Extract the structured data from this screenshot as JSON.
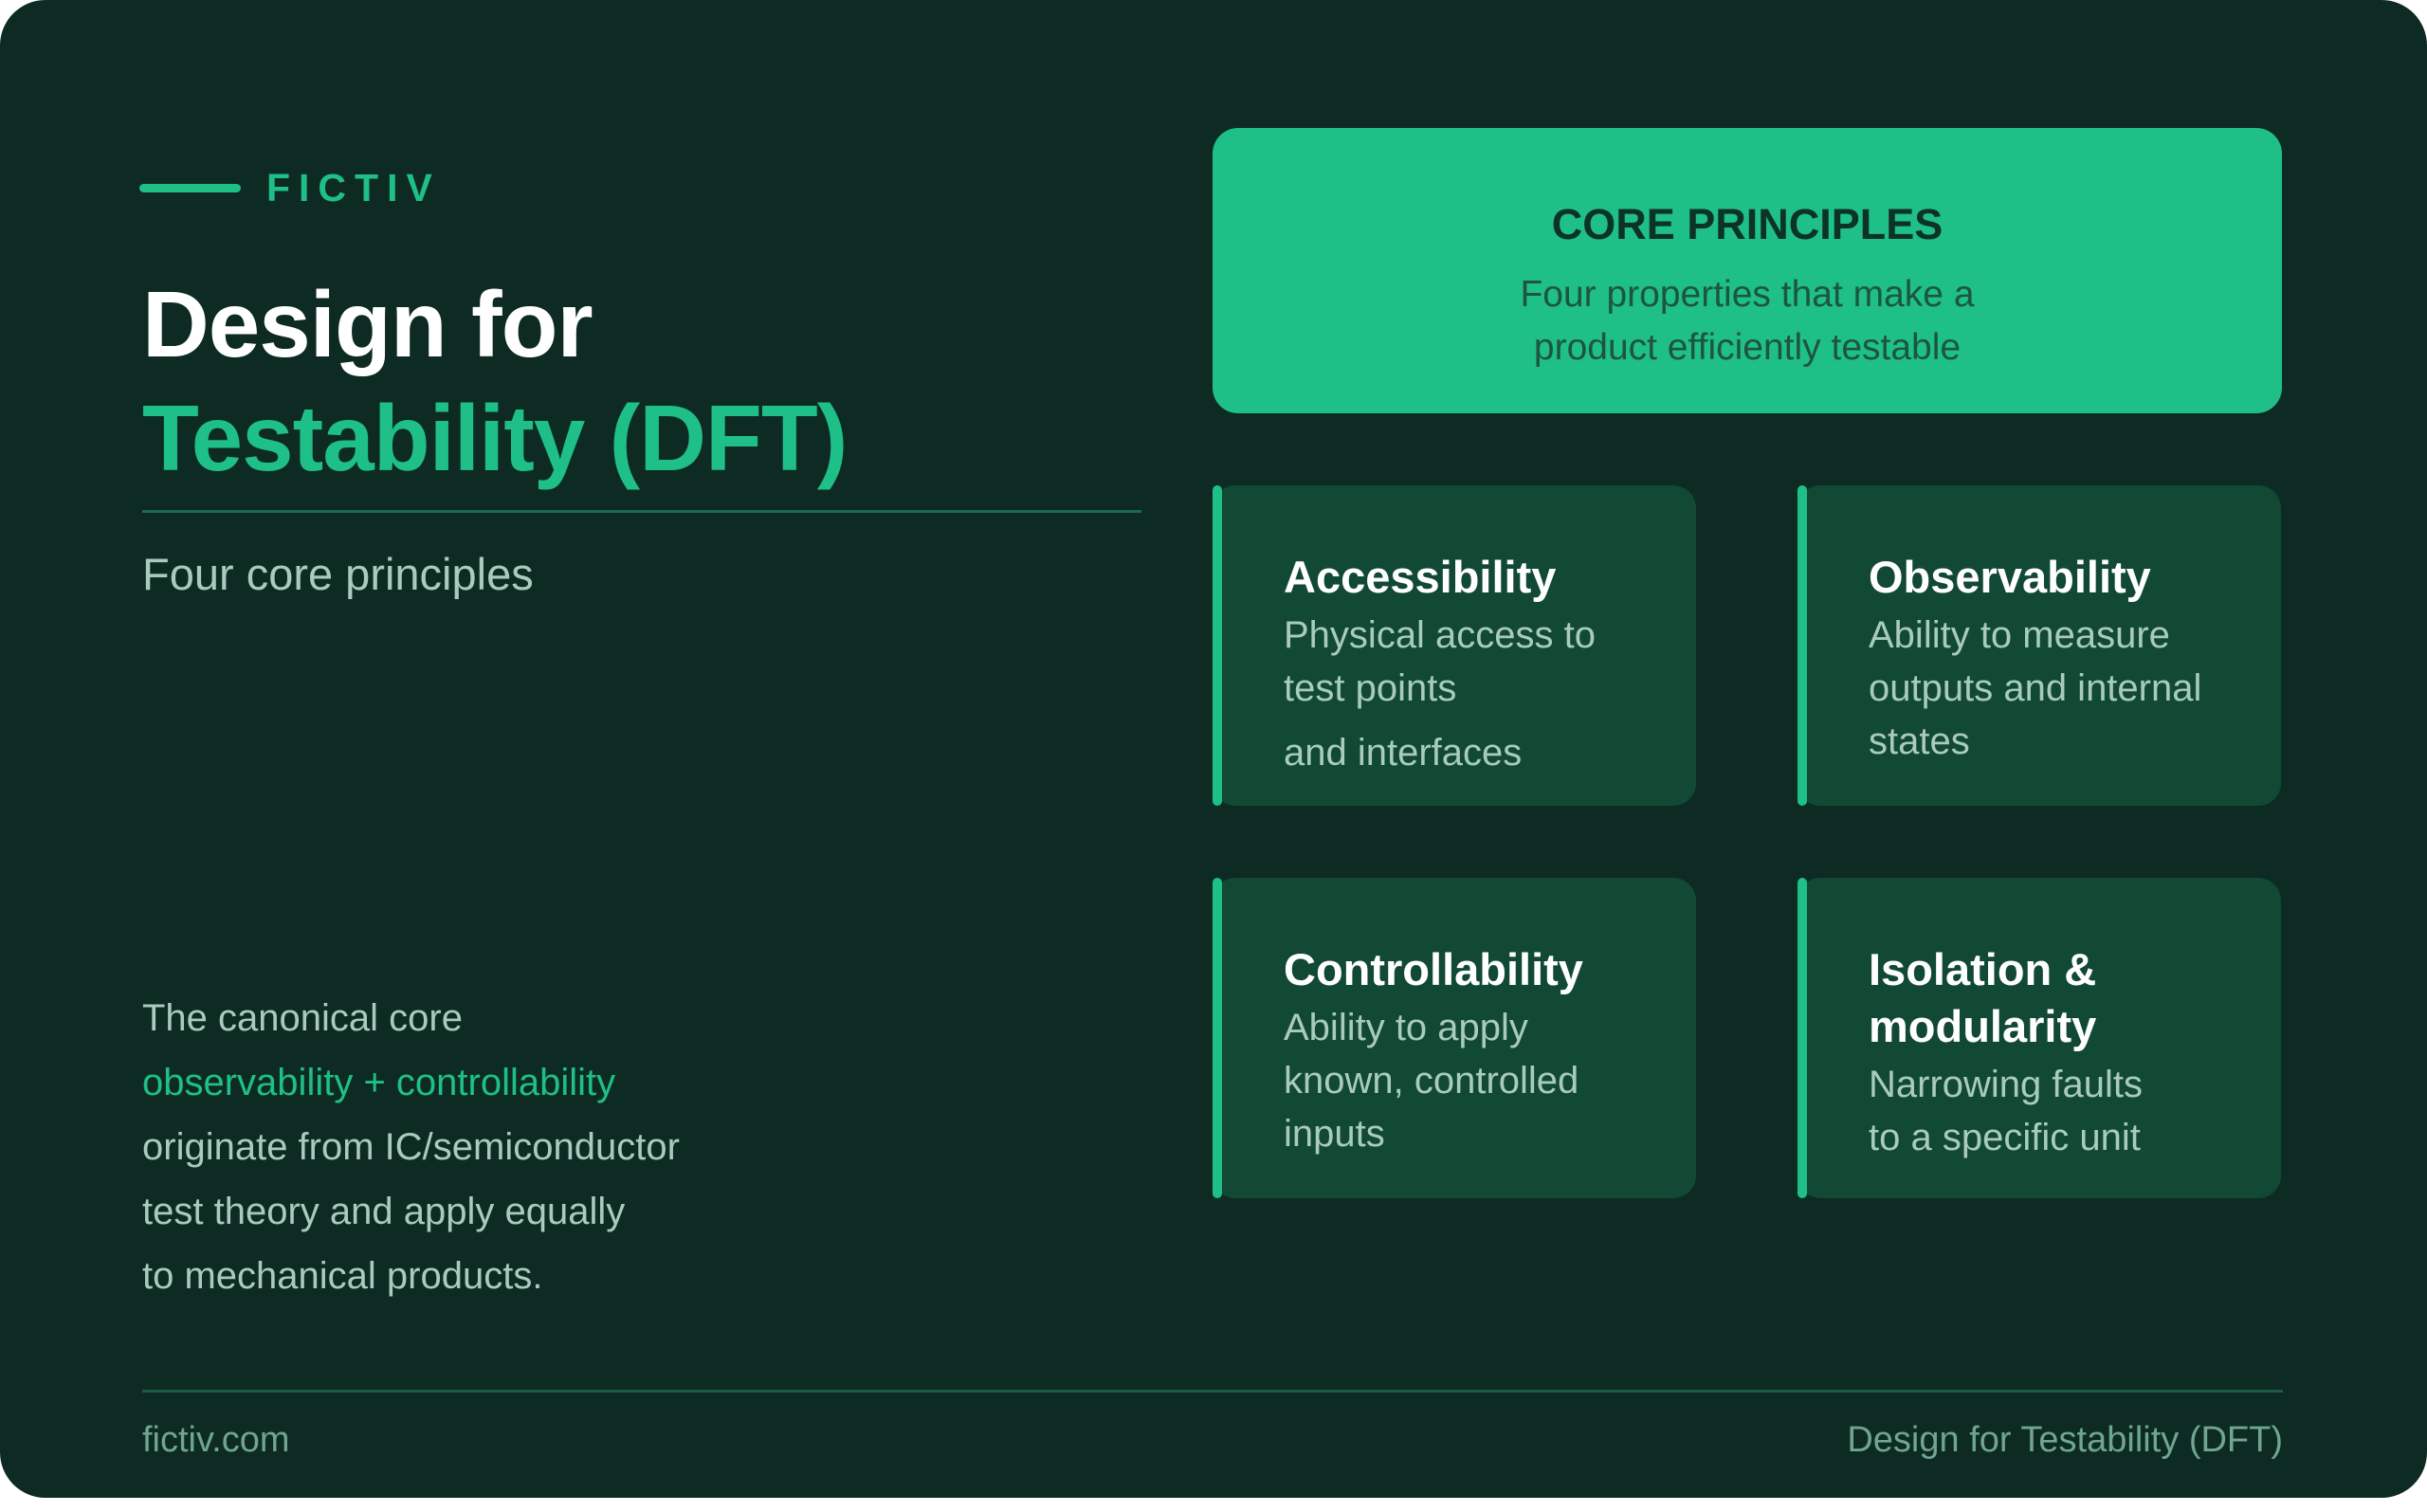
{
  "brand": {
    "name": "FICTIV"
  },
  "title": {
    "line1": "Design for",
    "line2": "Testability (DFT)"
  },
  "subtitle": "Four core principles",
  "note": {
    "line1": "The canonical core",
    "line2_highlight": "observability + controllability",
    "line3": "originate from IC/semiconductor",
    "line4": "test theory and apply equally",
    "line5": "to mechanical products."
  },
  "core": {
    "title": "CORE PRINCIPLES",
    "desc_line1": "Four properties that make a",
    "desc_line2": "product efficiently testable"
  },
  "principles": [
    {
      "title_lines": [
        "Accessibility"
      ],
      "desc_lines": [
        "Physical access to",
        "test points",
        "and interfaces"
      ]
    },
    {
      "title_lines": [
        "Observability"
      ],
      "desc_lines": [
        "Ability to measure",
        "outputs and internal",
        "states"
      ]
    },
    {
      "title_lines": [
        "Controllability"
      ],
      "desc_lines": [
        "Ability to apply",
        "known, controlled",
        "inputs"
      ]
    },
    {
      "title_lines": [
        "Isolation &",
        "modularity"
      ],
      "desc_lines": [
        "Narrowing faults",
        "to a specific unit"
      ]
    }
  ],
  "footer": {
    "left": "fictiv.com",
    "right": "Design for Testability (DFT)"
  },
  "colors": {
    "background": "#0d2b22",
    "accent": "#1fbf88",
    "card": "#114935",
    "muted_text": "#a9cbbd"
  }
}
